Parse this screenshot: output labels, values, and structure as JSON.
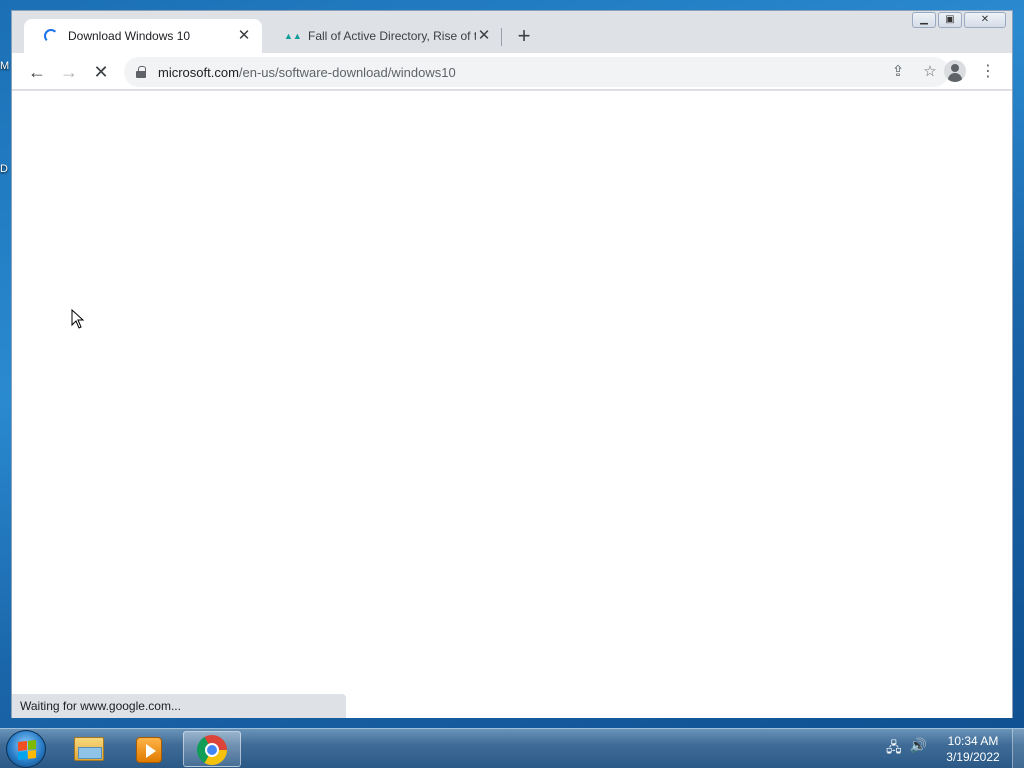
{
  "desktop": {
    "fragments": [
      "M",
      "D"
    ]
  },
  "browser": {
    "tabs": [
      {
        "title": "Download Windows 10",
        "active": true,
        "loading": true
      },
      {
        "title": "Fall of Active Directory, Rise of th",
        "active": false
      }
    ],
    "new_tab_label": "+",
    "window_controls": {
      "minimize": "▭",
      "maximize": "□",
      "close": "✕"
    },
    "toolbar": {
      "back": "←",
      "forward": "→",
      "stop": "✕",
      "url_host": "microsoft.com",
      "url_path": "/en-us/software-download/windows10",
      "share_icon": "⇪",
      "star_icon": "☆",
      "menu_icon": "⋮"
    },
    "status": "Waiting for www.google.com..."
  },
  "taskbar": {
    "apps": [
      {
        "name": "windows-explorer",
        "active": false
      },
      {
        "name": "media-player",
        "active": false
      },
      {
        "name": "google-chrome",
        "active": true
      }
    ],
    "tray_icons": [
      "network-icon",
      "volume-icon"
    ],
    "clock": {
      "time": "10:34 AM",
      "date": "3/19/2022"
    }
  }
}
